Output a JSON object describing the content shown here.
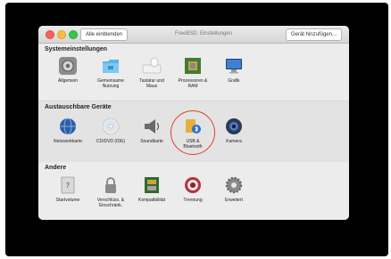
{
  "window": {
    "title": "FreeBSD: Einstellungen",
    "show_all_label": "Alle einblenden",
    "add_device_label": "Gerät hinzufügen..."
  },
  "sections": [
    {
      "title": "Systemeinstellungen",
      "items": [
        {
          "label": "Allgemein",
          "icon": "general-icon"
        },
        {
          "label": "Gemeinsame\nNutzung",
          "icon": "sharing-folder-icon"
        },
        {
          "label": "Tastatur und\nMaus",
          "icon": "keyboard-mouse-icon"
        },
        {
          "label": "Prozessoren &\nRAM",
          "icon": "cpu-chip-icon"
        },
        {
          "label": "Grafik",
          "icon": "display-icon"
        }
      ]
    },
    {
      "title": "Austauschbare Geräte",
      "items": [
        {
          "label": "Netzwerkkarte",
          "icon": "network-globe-icon"
        },
        {
          "label": "CD/DVD (IDE)",
          "icon": "cd-dvd-icon"
        },
        {
          "label": "Soundkarte",
          "icon": "speaker-icon"
        },
        {
          "label": "USB &\nBluetooth",
          "icon": "usb-bluetooth-icon"
        },
        {
          "label": "Kamera",
          "icon": "camera-icon"
        }
      ]
    },
    {
      "title": "Andere",
      "items": [
        {
          "label": "Startvolume",
          "icon": "startup-disk-icon"
        },
        {
          "label": "Verschlüss. &\nEinschränk.",
          "icon": "lock-icon"
        },
        {
          "label": "Kompatibilität",
          "icon": "compatibility-board-icon"
        },
        {
          "label": "Trennung",
          "icon": "isolation-icon"
        },
        {
          "label": "Erweitert",
          "icon": "gear-icon"
        }
      ]
    }
  ],
  "colors": {
    "highlight_circle": "#e0412c",
    "window_bg": "#ececec",
    "backdrop": "#000000"
  }
}
